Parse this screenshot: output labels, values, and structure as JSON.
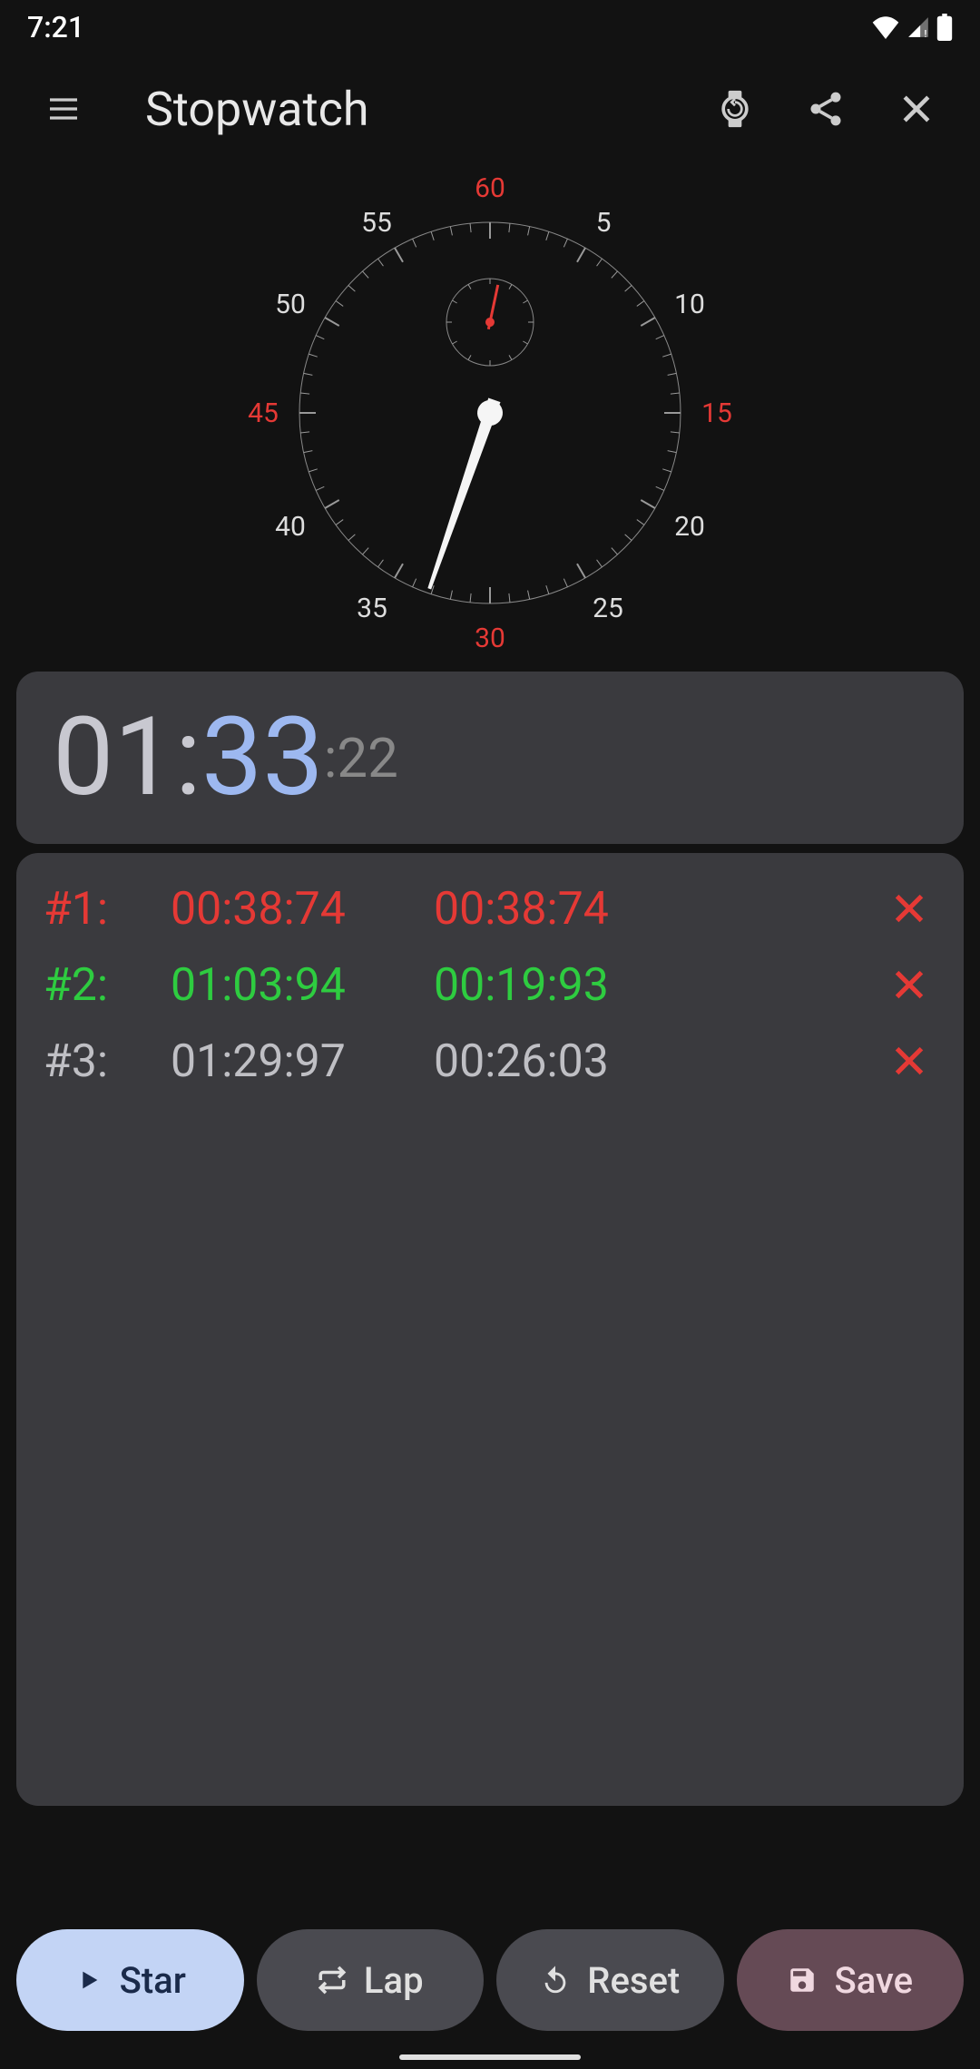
{
  "status": {
    "time": "7:21"
  },
  "header": {
    "title": "Stopwatch"
  },
  "dial": {
    "numbers": {
      "n60": "60",
      "n5": "5",
      "n10": "10",
      "n15": "15",
      "n20": "20",
      "n25": "25",
      "n30": "30",
      "n35": "35",
      "n40": "40",
      "n45": "45",
      "n50": "50",
      "n55": "55"
    },
    "seconds_angle": 199,
    "minutes_angle": 12
  },
  "time": {
    "min": "01",
    "sec": "33",
    "cs": "22"
  },
  "laps": [
    {
      "idx": "#1:",
      "total": "00:38:74",
      "split": "00:38:74",
      "color": "red"
    },
    {
      "idx": "#2:",
      "total": "01:03:94",
      "split": "00:19:93",
      "color": "green"
    },
    {
      "idx": "#3:",
      "total": "01:29:97",
      "split": "00:26:03",
      "color": "grey"
    }
  ],
  "buttons": {
    "start": "Star",
    "lap": "Lap",
    "reset": "Reset",
    "save": "Save"
  }
}
